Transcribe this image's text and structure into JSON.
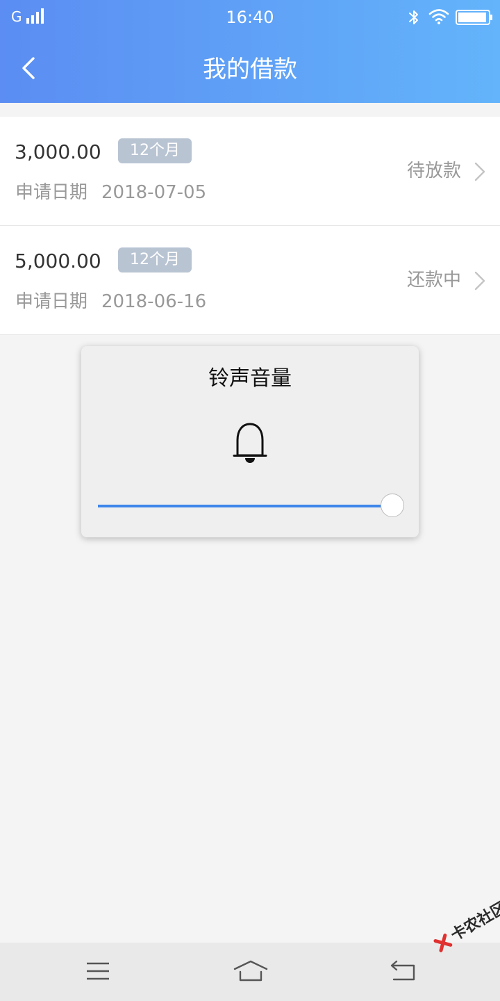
{
  "status_bar": {
    "carrier": "G",
    "time": "16:40",
    "battery_level": 0.95
  },
  "header": {
    "title": "我的借款"
  },
  "loans": [
    {
      "amount": "3,000.00",
      "term": "12个月",
      "date_label": "申请日期",
      "date": "2018-07-05",
      "status": "待放款"
    },
    {
      "amount": "5,000.00",
      "term": "12个月",
      "date_label": "申请日期",
      "date": "2018-06-16",
      "status": "还款中"
    }
  ],
  "volume_dialog": {
    "title": "铃声音量",
    "level": 1.0
  },
  "watermark": {
    "text": "卡农社区"
  },
  "colors": {
    "header_start": "#5b8df2",
    "header_end": "#63b4fb",
    "term_badge": "#b9c4d3",
    "slider_fill": "#3d86ea"
  },
  "icons": {
    "back": "chevron-left-icon",
    "row_arrow": "chevron-right-icon",
    "bell": "bell-icon",
    "menu": "menu-icon",
    "home": "home-icon",
    "return": "return-icon"
  }
}
